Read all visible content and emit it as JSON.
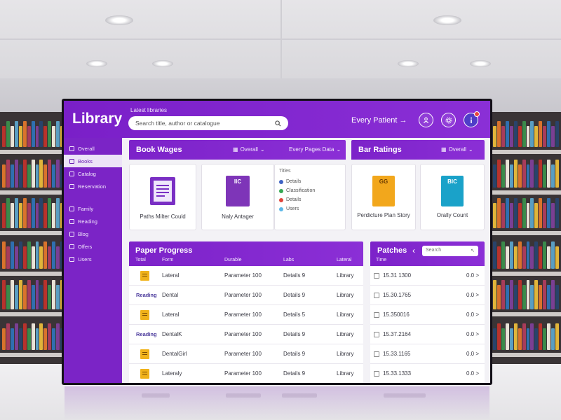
{
  "app": {
    "title": "Library",
    "search_label": "Latest libraries",
    "search_placeholder": "Search title, author or catalogue",
    "top_link": "Every Patient →",
    "icons": [
      "user-icon",
      "settings-icon",
      "info-icon"
    ]
  },
  "sidebar": {
    "items": [
      {
        "label": "Overall",
        "active": false
      },
      {
        "label": "Books",
        "active": true
      },
      {
        "label": "Catalog",
        "active": false
      },
      {
        "label": "Reservation",
        "active": false
      },
      {
        "label": "Family",
        "active": false
      },
      {
        "label": "Reading",
        "active": false
      },
      {
        "label": "Blog",
        "active": false
      },
      {
        "label": "Offers",
        "active": false
      },
      {
        "label": "Users",
        "active": false
      }
    ]
  },
  "book_wages": {
    "title": "Book Wages",
    "ctrl1": "Overall",
    "ctrl2": "Every Pages Data",
    "cards": [
      {
        "caption": "Paths Milter Could",
        "cover_text": "",
        "color": "#7a2fc4"
      },
      {
        "caption": "Naly Antager",
        "cover_text": "IIC",
        "color": "#7e35b8"
      }
    ],
    "legend_title": "Titles",
    "legend": [
      {
        "label": "Details",
        "color": "#3f63c4"
      },
      {
        "label": "Classification",
        "color": "#35a853"
      },
      {
        "label": "Details",
        "color": "#e0453c"
      },
      {
        "label": "Users",
        "color": "#5bb7e8"
      }
    ]
  },
  "bar_ratings": {
    "title": "Bar Ratings",
    "ctrl": "Overall",
    "cards": [
      {
        "caption": "Perdicture Plan Story",
        "cover_text": "GG",
        "color": "#f2a71c"
      },
      {
        "caption": "Orally Count",
        "cover_text": "BIC",
        "color": "#1aa2c9"
      }
    ]
  },
  "table": {
    "title": "Paper Progress",
    "headers": [
      "Total",
      "Form",
      "Durable",
      "Labs",
      "Lateral"
    ],
    "rows": [
      {
        "label": "",
        "c1": "Lateral",
        "c2": "Parameter 100",
        "c3": "Details 9",
        "c4": "Library"
      },
      {
        "label": "Reading",
        "c1": "Dental",
        "c2": "Parameter 100",
        "c3": "Details 9",
        "c4": "Library"
      },
      {
        "label": "",
        "c1": "Lateral",
        "c2": "Parameter 100",
        "c3": "Details 5",
        "c4": "Library"
      },
      {
        "label": "Reading",
        "c1": "DentalK",
        "c2": "Parameter 100",
        "c3": "Details 9",
        "c4": "Library"
      },
      {
        "label": "",
        "c1": "DentalGirl",
        "c2": "Parameter 100",
        "c3": "Details 9",
        "c4": "Library"
      },
      {
        "label": "",
        "c1": "Lateraly",
        "c2": "Parameter 100",
        "c3": "Details 9",
        "c4": "Library"
      }
    ]
  },
  "patches": {
    "title": "Patches",
    "search_placeholder": "Search",
    "header": "Time",
    "rows": [
      {
        "time": "15.31 1300",
        "value": "0.0 >"
      },
      {
        "time": "15.30.1765",
        "value": "0.0 >"
      },
      {
        "time": "15.350016",
        "value": "0.0 >"
      },
      {
        "time": "15.37.2164",
        "value": "0.0 >"
      },
      {
        "time": "15.33.1165",
        "value": "0.0 >"
      },
      {
        "time": "15.33.1333",
        "value": "0.0 >"
      }
    ]
  }
}
